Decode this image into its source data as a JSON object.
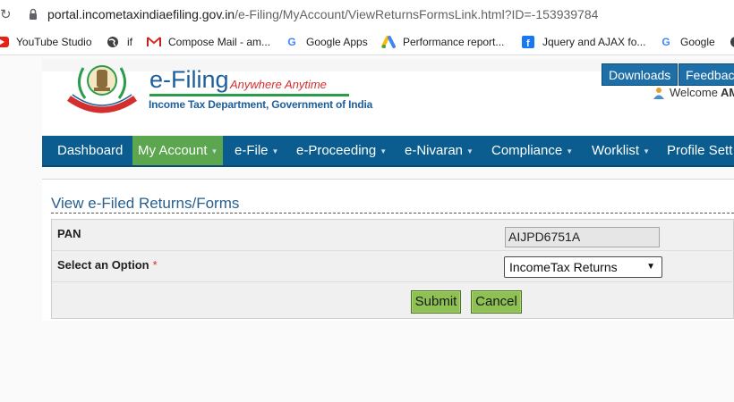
{
  "browser": {
    "url_host": "portal.incometaxindiaefiling.gov.in",
    "url_path": "/e-Filing/MyAccount/ViewReturnsFormsLink.html?ID=-153939784",
    "bookmarks": [
      {
        "label": "YouTube Studio",
        "icon": "youtube-icon"
      },
      {
        "label": "if",
        "icon": "globe-icon"
      },
      {
        "label": "Compose Mail - am...",
        "icon": "gmail-icon"
      },
      {
        "label": "Google Apps",
        "icon": "google-icon"
      },
      {
        "label": "Performance report...",
        "icon": "google-ads-icon"
      },
      {
        "label": "Jquery and AJAX fo...",
        "icon": "facebook-icon"
      },
      {
        "label": "Google",
        "icon": "google-icon"
      }
    ]
  },
  "header": {
    "logo_title": "e-Filing",
    "logo_tagline": "Anywhere Anytime",
    "logo_subtitle": "Income Tax Department, Government of India",
    "downloads_label": "Downloads",
    "feedback_label": "Feedbac",
    "welcome_prefix": "Welcome",
    "welcome_user": "AM"
  },
  "nav": {
    "items": [
      {
        "label": "Dashboard",
        "caret": false,
        "active": false
      },
      {
        "label": "My Account",
        "caret": true,
        "active": true
      },
      {
        "label": "e-File",
        "caret": true,
        "active": false
      },
      {
        "label": "e-Proceeding",
        "caret": true,
        "active": false
      },
      {
        "label": "e-Nivaran",
        "caret": true,
        "active": false
      },
      {
        "label": "Compliance",
        "caret": true,
        "active": false
      },
      {
        "label": "Worklist",
        "caret": true,
        "active": false
      },
      {
        "label": "Profile Sett",
        "caret": false,
        "active": false
      }
    ]
  },
  "form": {
    "title": "View e-Filed Returns/Forms",
    "pan_label": "PAN",
    "pan_value": "AIJPD6751A",
    "option_label": "Select an Option",
    "required_mark": "*",
    "option_value": "IncomeTax Returns",
    "submit_label": "Submit",
    "cancel_label": "Cancel"
  },
  "colors": {
    "nav_bg": "#0a5d8e",
    "nav_active": "#5ba64f",
    "button_green": "#8ec054",
    "title_blue": "#275f8e"
  }
}
